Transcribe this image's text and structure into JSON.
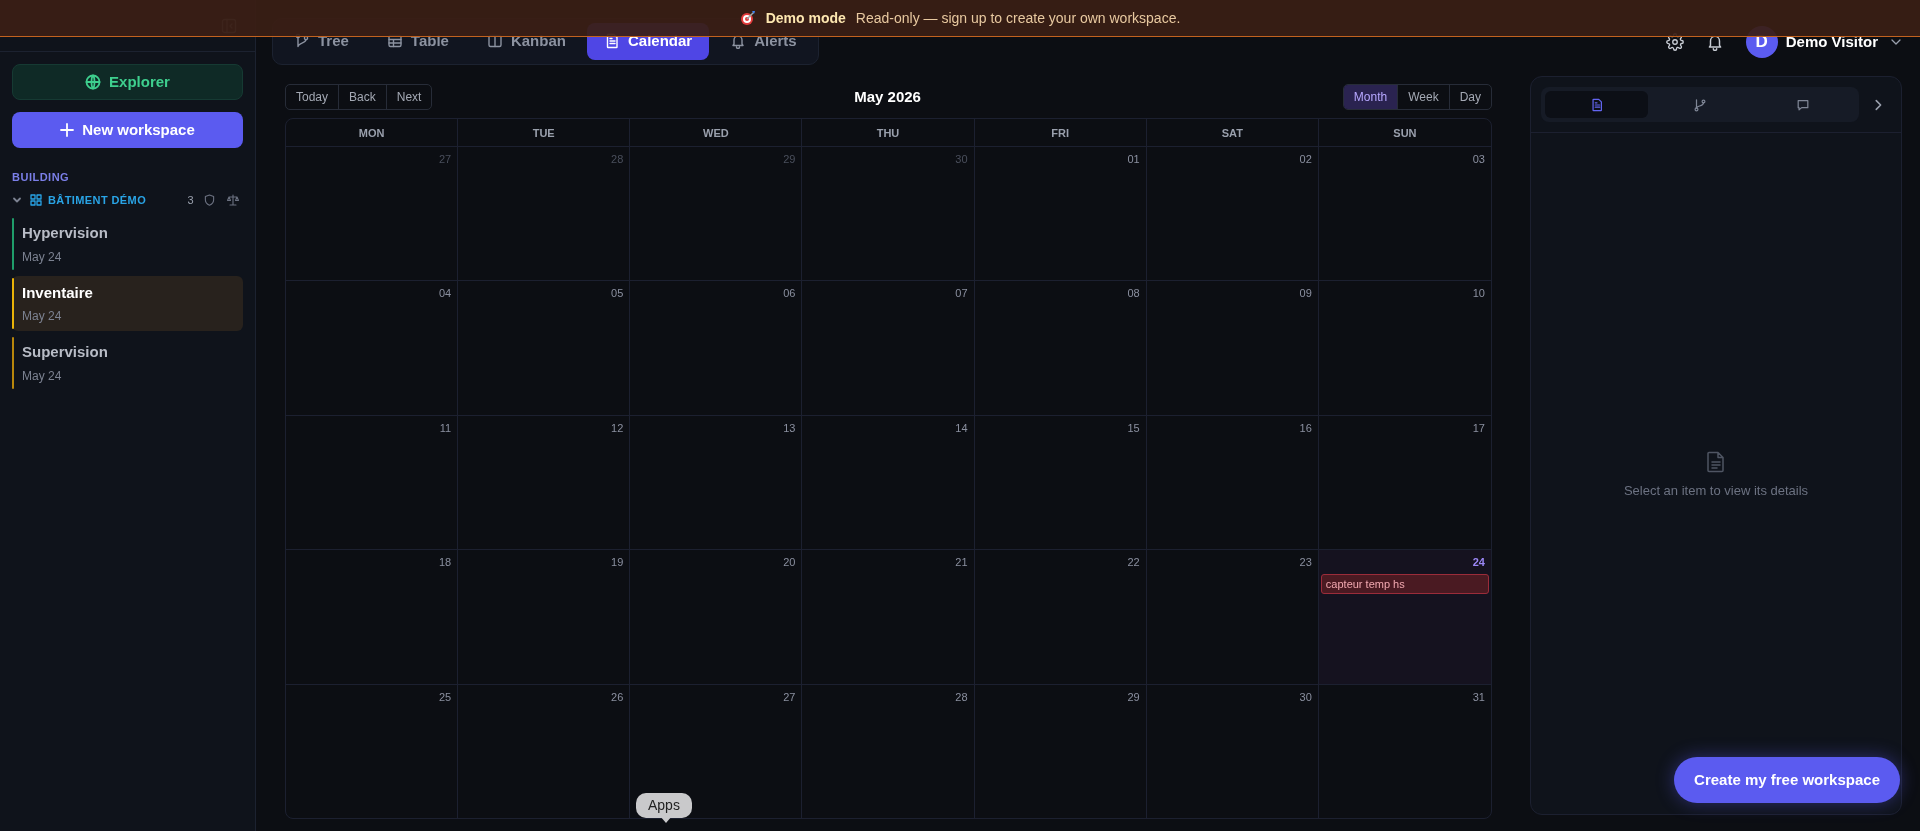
{
  "banner": {
    "title": "Demo mode",
    "message": "Read-only — sign up to create your own workspace."
  },
  "tabs": [
    {
      "label": "Tree",
      "selected": false
    },
    {
      "label": "Table",
      "selected": false
    },
    {
      "label": "Kanban",
      "selected": false
    },
    {
      "label": "Calendar",
      "selected": true
    },
    {
      "label": "Alerts",
      "selected": false
    }
  ],
  "user": {
    "initial": "D",
    "name": "Demo Visitor"
  },
  "sidebar": {
    "explorer_button": "Explorer",
    "new_workspace_button": "New workspace",
    "section": "BUILDING",
    "group": {
      "name": "BÂTIMENT DÉMO",
      "count": "3",
      "expanded": true,
      "items": [
        {
          "title": "Hypervision",
          "date": "May 24",
          "color": "#1f9d6a",
          "selected": false
        },
        {
          "title": "Inventaire",
          "date": "May 24",
          "color": "#eab308",
          "selected": true
        },
        {
          "title": "Supervision",
          "date": "May 24",
          "color": "#b8860b",
          "selected": false
        }
      ]
    }
  },
  "calendar": {
    "nav": [
      "Today",
      "Back",
      "Next"
    ],
    "title": "May 2026",
    "views": [
      {
        "label": "Month",
        "selected": true
      },
      {
        "label": "Week",
        "selected": false
      },
      {
        "label": "Day",
        "selected": false
      }
    ],
    "weekdays": [
      "MON",
      "TUE",
      "WED",
      "THU",
      "FRI",
      "SAT",
      "SUN"
    ],
    "weeks": [
      [
        {
          "day": "27",
          "muted": true,
          "today": false
        },
        {
          "day": "28",
          "muted": true,
          "today": false
        },
        {
          "day": "29",
          "muted": true,
          "today": false
        },
        {
          "day": "30",
          "muted": true,
          "today": false
        },
        {
          "day": "01",
          "muted": false,
          "today": false
        },
        {
          "day": "02",
          "muted": false,
          "today": false
        },
        {
          "day": "03",
          "muted": false,
          "today": false
        }
      ],
      [
        {
          "day": "04",
          "muted": false,
          "today": false
        },
        {
          "day": "05",
          "muted": false,
          "today": false
        },
        {
          "day": "06",
          "muted": false,
          "today": false
        },
        {
          "day": "07",
          "muted": false,
          "today": false
        },
        {
          "day": "08",
          "muted": false,
          "today": false
        },
        {
          "day": "09",
          "muted": false,
          "today": false
        },
        {
          "day": "10",
          "muted": false,
          "today": false
        }
      ],
      [
        {
          "day": "11",
          "muted": false,
          "today": false
        },
        {
          "day": "12",
          "muted": false,
          "today": false
        },
        {
          "day": "13",
          "muted": false,
          "today": false
        },
        {
          "day": "14",
          "muted": false,
          "today": false
        },
        {
          "day": "15",
          "muted": false,
          "today": false
        },
        {
          "day": "16",
          "muted": false,
          "today": false
        },
        {
          "day": "17",
          "muted": false,
          "today": false
        }
      ],
      [
        {
          "day": "18",
          "muted": false,
          "today": false
        },
        {
          "day": "19",
          "muted": false,
          "today": false
        },
        {
          "day": "20",
          "muted": false,
          "today": false
        },
        {
          "day": "21",
          "muted": false,
          "today": false
        },
        {
          "day": "22",
          "muted": false,
          "today": false
        },
        {
          "day": "23",
          "muted": false,
          "today": false
        },
        {
          "day": "24",
          "muted": false,
          "today": true,
          "events": [
            {
              "title": "capteur temp hs"
            }
          ]
        }
      ],
      [
        {
          "day": "25",
          "muted": false,
          "today": false
        },
        {
          "day": "26",
          "muted": false,
          "today": false
        },
        {
          "day": "27",
          "muted": false,
          "today": false
        },
        {
          "day": "28",
          "muted": false,
          "today": false
        },
        {
          "day": "29",
          "muted": false,
          "today": false
        },
        {
          "day": "30",
          "muted": false,
          "today": false
        },
        {
          "day": "31",
          "muted": false,
          "today": false
        }
      ]
    ]
  },
  "details_panel": {
    "tabs": [
      {
        "selected": true
      },
      {
        "selected": false
      },
      {
        "selected": false
      }
    ],
    "message": "Select an item to view its details"
  },
  "cta_button": "Create my free workspace",
  "tooltip": "Apps"
}
